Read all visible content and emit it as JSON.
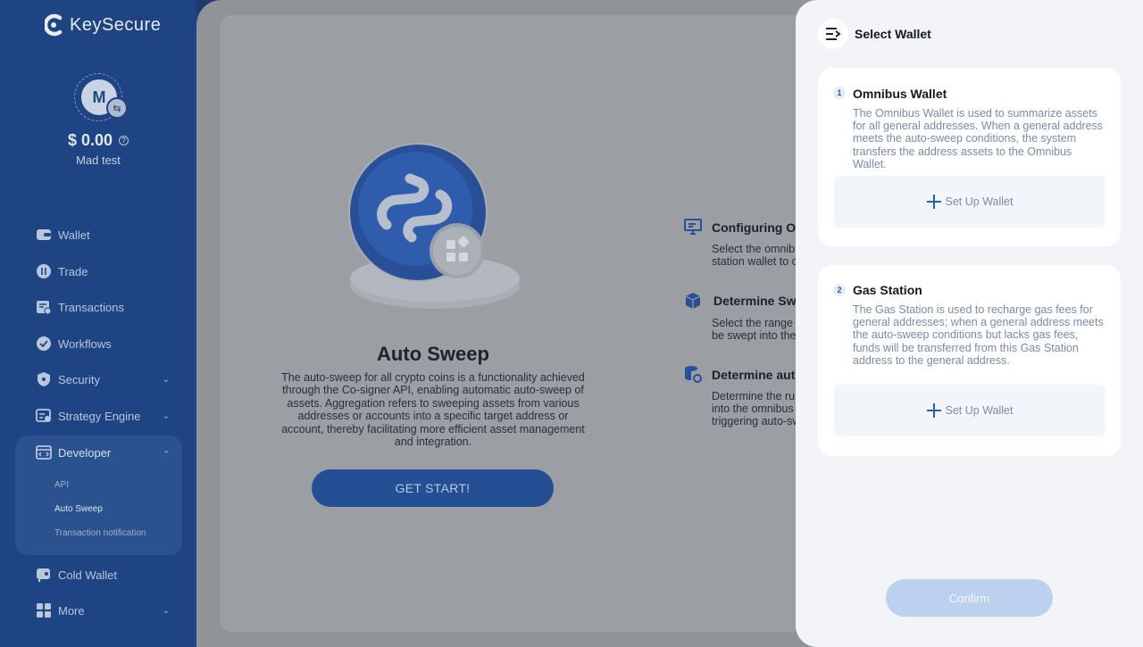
{
  "brand": {
    "name": "KeySecure"
  },
  "account": {
    "avatar_letter": "M",
    "balance": "$ 0.00",
    "name": "Mad test"
  },
  "nav": {
    "wallet": "Wallet",
    "trade": "Trade",
    "transactions": "Transactions",
    "workflows": "Workflows",
    "security": "Security",
    "strategy_engine": "Strategy Engine",
    "developer": "Developer",
    "developer_sub": {
      "api": "API",
      "auto_sweep": "Auto Sweep",
      "transaction_notification": "Transaction notification"
    },
    "cold_wallet": "Cold Wallet",
    "more": "More"
  },
  "main": {
    "title": "Auto Sweep",
    "description": "The auto-sweep for all crypto coins is a functionality achieved through the Co-signer API, enabling automatic auto-sweep of assets. Aggregation refers to sweeping assets from various addresses or accounts into a specific target address or account, thereby facilitating more efficient asset management and integration.",
    "start_button": "GET START!",
    "steps": [
      {
        "title": "Configuring Om",
        "line1": "Select the omnibu",
        "line2": "station wallet to c",
        "line3": ""
      },
      {
        "title": "Determine Swe",
        "line1": "Select the range o",
        "line2": "be swept into the",
        "line3": ""
      },
      {
        "title": "Determine auto",
        "line1": "Determine the rul",
        "line2": "into the omnibus",
        "line3": "triggering auto-sw"
      }
    ]
  },
  "drawer": {
    "title": "Select Wallet",
    "cards": [
      {
        "num": "1",
        "title": "Omnibus Wallet",
        "description": "The Omnibus Wallet is used to summarize assets for all general addresses. When a general address meets the auto-sweep conditions, the system transfers the address assets to the Omnibus Wallet.",
        "button": "Set Up Wallet"
      },
      {
        "num": "2",
        "title": "Gas Station",
        "description": "The Gas Station is used to recharge gas fees for general addresses; when a general address meets the auto-sweep conditions but lacks gas fees, funds will be transferred from this Gas Station address to the general address.",
        "button": "Set Up Wallet"
      }
    ],
    "confirm": "Confirm"
  },
  "colors": {
    "sidebar": "#1e4483",
    "accent": "#2c5db0",
    "overlay_main": "#909398",
    "drawer": "#f2f4f7",
    "confirm_disabled": "#bcd0ef"
  }
}
